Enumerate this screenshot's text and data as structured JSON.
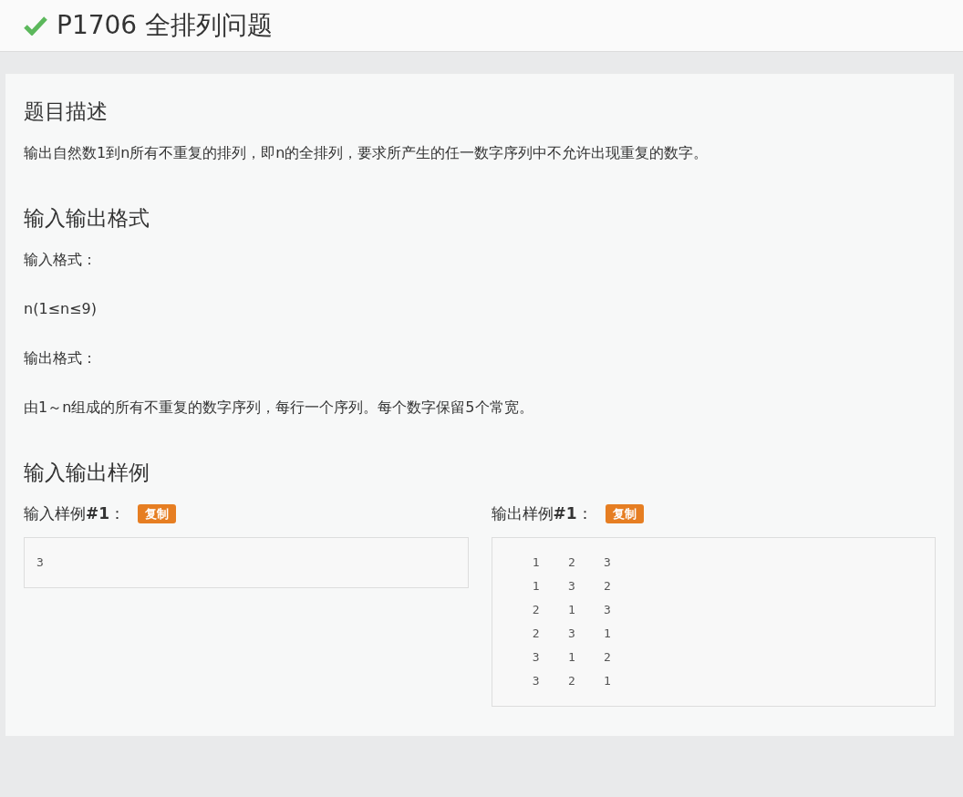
{
  "header": {
    "title": "P1706 全排列问题",
    "solved": true
  },
  "sections": [
    {
      "heading": "题目描述",
      "paragraphs": [
        "输出自然数1到n所有不重复的排列，即n的全排列，要求所产生的任一数字序列中不允许出现重复的数字。"
      ]
    },
    {
      "heading": "输入输出格式",
      "paragraphs": [
        "输入格式：",
        "n(1≤n≤9)",
        "输出格式：",
        "由1～n组成的所有不重复的数字序列，每行一个序列。每个数字保留5个常宽。"
      ]
    }
  ],
  "samples": {
    "heading": "输入输出样例",
    "items": [
      {
        "label": "输入样例**#1**：",
        "copy_button": "复制",
        "lines": [
          "3"
        ]
      },
      {
        "label": "输出样例**#1**：",
        "copy_button": "复制",
        "lines": [
          "    1    2    3",
          "    1    3    2",
          "    2    1    3",
          "    2    3    1",
          "    3    1    2",
          "    3    2    1"
        ]
      }
    ]
  }
}
